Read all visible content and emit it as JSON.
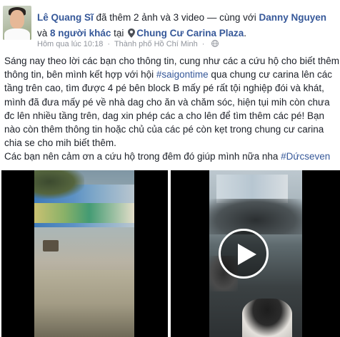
{
  "header": {
    "author": "Lê Quang Sĩ",
    "action": " đã thêm 2 ảnh và 3 video — cùng với ",
    "tagged_person": "Danny Nguyen",
    "and_text": " và ",
    "others": "8 người khác",
    "at_text": " tại ",
    "place": "Chung Cư Carina Plaza",
    "place_end": "."
  },
  "meta": {
    "time": "Hôm qua lúc 10:18",
    "separator": "·",
    "location": "Thành phố Hồ Chí Minh",
    "separator2": "·"
  },
  "post": {
    "p1_a": "Sáng nay theo lời các bạn cho thông tin, cung như các a cứu hộ cho biết thêm thông tin, bên mình kết hợp với hội ",
    "p1_tag": "#saigontime",
    "p1_b": " qua chung cư carina lên các tầng trên cao, tìm được 4 pé bên block B mấy pé rất tội nghiệp đói và khát, mình đã đưa mấy pé về nhà dag cho ăn và chăm sóc, hiện tụi mih còn chưa đc lên nhiều tầng trên, dag xin phép các a cho lên để tìm thêm các pé! Bạn nào còn thêm thông tin hoặc chủ của các pé còn kẹt trong chung cư carina chia se cho mih biết thêm.",
    "p2_a": "Các bạn nên cảm ơn a cứu hộ trong đêm đó giúp mình nữa nha ",
    "p2_tag": "#Dứcseven"
  },
  "media": {
    "items": [
      {
        "kind": "video",
        "icon": "video-thumbnail-plaza"
      },
      {
        "kind": "video",
        "icon": "play-icon"
      }
    ]
  },
  "colors": {
    "link": "#365899",
    "meta": "#90949c",
    "text": "#1d2129"
  }
}
